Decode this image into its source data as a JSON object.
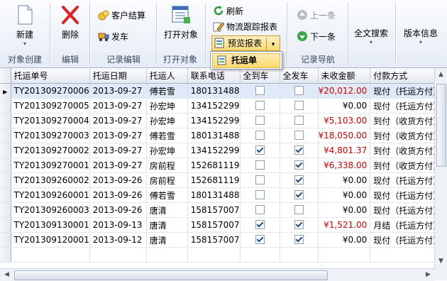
{
  "ribbon": {
    "groups": [
      {
        "label": "对象创建"
      },
      {
        "label": "编辑"
      },
      {
        "label": "记录编辑"
      },
      {
        "label": "打开对象"
      },
      {
        "label": "记录导航"
      }
    ],
    "new_label": "新建",
    "delete_label": "删除",
    "customer_settle_label": "客户结算",
    "ship_label": "发车",
    "open_object_label": "打开对象",
    "refresh_label": "刷新",
    "tracking_report_label": "物流跟踪报表",
    "preview_report_label": "预览报表",
    "prev_label": "上一条",
    "next_label": "下一条",
    "fulltext_search_label": "全文搜索",
    "version_info_label": "版本信息"
  },
  "dropdown": {
    "item_label": "托运单"
  },
  "table": {
    "columns": [
      "托运单号",
      "托运日期",
      "托运人",
      "联系电话",
      "全到车",
      "全发车",
      "未收金额",
      "付款方式"
    ],
    "rows": [
      {
        "id": "TY201309270006",
        "date": "2013-09-27",
        "shipper": "傅若雪",
        "phone": "180131488",
        "arrived": false,
        "dispatched": false,
        "amount": "¥20,012.00",
        "red": true,
        "payment": "现付（托运方付）"
      },
      {
        "id": "TY201309270005",
        "date": "2013-09-27",
        "shipper": "孙宏坤",
        "phone": "134152299",
        "arrived": false,
        "dispatched": false,
        "amount": "¥0.00",
        "red": false,
        "payment": "现付（托运方付）"
      },
      {
        "id": "TY201309270004",
        "date": "2013-09-27",
        "shipper": "孙宏坤",
        "phone": "134152299",
        "arrived": false,
        "dispatched": false,
        "amount": "¥5,103.00",
        "red": true,
        "payment": "到付（收货方付）"
      },
      {
        "id": "TY201309270003",
        "date": "2013-09-27",
        "shipper": "傅若雪",
        "phone": "180131488",
        "arrived": false,
        "dispatched": false,
        "amount": "¥18,050.00",
        "red": true,
        "payment": "到付（收货方付）"
      },
      {
        "id": "TY201309270002",
        "date": "2013-09-27",
        "shipper": "孙宏坤",
        "phone": "134152299",
        "arrived": true,
        "dispatched": true,
        "amount": "¥4,801.37",
        "red": true,
        "payment": "到付（收货方付）"
      },
      {
        "id": "TY201309270001",
        "date": "2013-09-27",
        "shipper": "房前程",
        "phone": "152681119",
        "arrived": false,
        "dispatched": true,
        "amount": "¥6,338.00",
        "red": true,
        "payment": "到付（收货方付）"
      },
      {
        "id": "TY201309260002",
        "date": "2013-09-26",
        "shipper": "房前程",
        "phone": "152681119",
        "arrived": false,
        "dispatched": true,
        "amount": "¥0.00",
        "red": false,
        "payment": "现付（托运方付）"
      },
      {
        "id": "TY201309260001",
        "date": "2013-09-26",
        "shipper": "傅若雪",
        "phone": "180131488",
        "arrived": false,
        "dispatched": true,
        "amount": "¥0.00",
        "red": false,
        "payment": "现付（托运方付）"
      },
      {
        "id": "TY201309260003",
        "date": "2013-09-26",
        "shipper": "唐清",
        "phone": "158157007",
        "arrived": false,
        "dispatched": false,
        "amount": "¥0.00",
        "red": false,
        "payment": "现付（托运方付）"
      },
      {
        "id": "TY201309130001",
        "date": "2013-09-13",
        "shipper": "唐清",
        "phone": "158157007",
        "arrived": true,
        "dispatched": true,
        "amount": "¥1,521.00",
        "red": true,
        "payment": "月结（托运方付）"
      },
      {
        "id": "TY201309120001",
        "date": "2013-09-12",
        "shipper": "唐清",
        "phone": "158157007",
        "arrived": true,
        "dispatched": true,
        "amount": "¥0.00",
        "red": false,
        "payment": "现付（托运方付）"
      }
    ]
  }
}
